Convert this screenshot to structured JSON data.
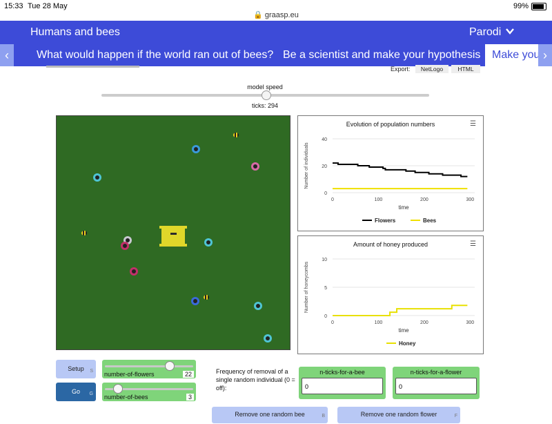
{
  "status": {
    "time": "15:33",
    "date": "Tue 28 May",
    "url": "graasp.eu",
    "battery": "99%"
  },
  "header": {
    "title": "Humans and bees",
    "user": "Parodi"
  },
  "tabs": [
    {
      "label": "What would happen if the world ran out of bees?"
    },
    {
      "label": "Be a scientist and make your hypothesis"
    },
    {
      "label": "Make you"
    }
  ],
  "export": {
    "label": "Export:",
    "netlogo": "NetLogo",
    "html": "HTML"
  },
  "speed": {
    "label": "model speed",
    "value": 0.5
  },
  "ticks": {
    "label": "ticks: 294"
  },
  "icons": {
    "back": "chevron-left-icon",
    "forward": "chevron-right-icon",
    "dropdown": "chevron-down-icon",
    "menu": "hamburger-menu-icon"
  },
  "colors": {
    "header": "#3d4bd8",
    "world": "#2f6a23",
    "control_green": "#7fd47a",
    "button_blue": "#b8c8f5",
    "flowers_line": "#000000",
    "bees_line": "#f0e000",
    "honey_line": "#e8e000",
    "hive": "#e0d72a"
  },
  "chart_population": {
    "title": "Evolution of population numbers",
    "ylabel": "Number of individuals",
    "xlabel": "time",
    "yticks": [
      "0",
      "20",
      "40"
    ],
    "xticks": [
      "0",
      "100",
      "200",
      "300"
    ],
    "legend": [
      {
        "name": "Flowers"
      },
      {
        "name": "Bees"
      }
    ]
  },
  "chart_honey": {
    "title": "Amount of honey produced",
    "ylabel": "Number of honeycombs",
    "xlabel": "time",
    "yticks": [
      "0",
      "5",
      "10"
    ],
    "xticks": [
      "0",
      "100",
      "200",
      "300"
    ],
    "legend": [
      {
        "name": "Honey"
      }
    ]
  },
  "chart_data": [
    {
      "type": "line",
      "title": "Evolution of population numbers",
      "xlabel": "time",
      "ylabel": "Number of individuals",
      "xlim": [
        0,
        310
      ],
      "ylim": [
        0,
        40
      ],
      "legend_position": "bottom",
      "series": [
        {
          "name": "Flowers",
          "x": [
            0,
            10,
            12,
            50,
            55,
            75,
            80,
            90,
            100,
            110,
            115,
            150,
            160,
            170,
            180,
            200,
            210,
            230,
            240,
            270,
            280,
            294
          ],
          "y": [
            22,
            22,
            21,
            21,
            20,
            20,
            19,
            19,
            19,
            18,
            17,
            17,
            16,
            16,
            15,
            15,
            14,
            14,
            13,
            13,
            12,
            12
          ]
        },
        {
          "name": "Bees",
          "x": [
            0,
            294
          ],
          "y": [
            3,
            3
          ]
        }
      ]
    },
    {
      "type": "line",
      "title": "Amount of honey produced",
      "xlabel": "time",
      "ylabel": "Number of honeycombs",
      "xlim": [
        0,
        310
      ],
      "ylim": [
        0,
        10
      ],
      "legend_position": "bottom",
      "series": [
        {
          "name": "Honey",
          "x": [
            0,
            115,
            125,
            135,
            140,
            250,
            260,
            294
          ],
          "y": [
            0,
            0,
            0.6,
            0.6,
            1.2,
            1.2,
            1.8,
            1.8
          ]
        }
      ]
    }
  ],
  "world": {
    "flower_colors": [
      "#3a9ad9",
      "#4fc4d4",
      "#d86aa6",
      "#d8457a",
      "#c2306a"
    ]
  },
  "controls": {
    "setup": {
      "label": "Setup",
      "key": "S"
    },
    "go": {
      "label": "Go",
      "key": "G"
    },
    "flowers_slider": {
      "label": "number-of-flowers",
      "value": "22",
      "level": 0.75
    },
    "bees_slider": {
      "label": "number-of-bees",
      "value": "3",
      "level": 0.1
    },
    "frequency_label": "Frequency of removal of a single random individual (0 = off):",
    "bee_input": {
      "label": "n-ticks-for-a-bee",
      "value": "0"
    },
    "flower_input": {
      "label": "n-ticks-for-a-flower",
      "value": "0"
    },
    "remove_bee": {
      "label": "Remove one random bee",
      "key": "B"
    },
    "remove_flower": {
      "label": "Remove one random flower",
      "key": "F"
    }
  }
}
